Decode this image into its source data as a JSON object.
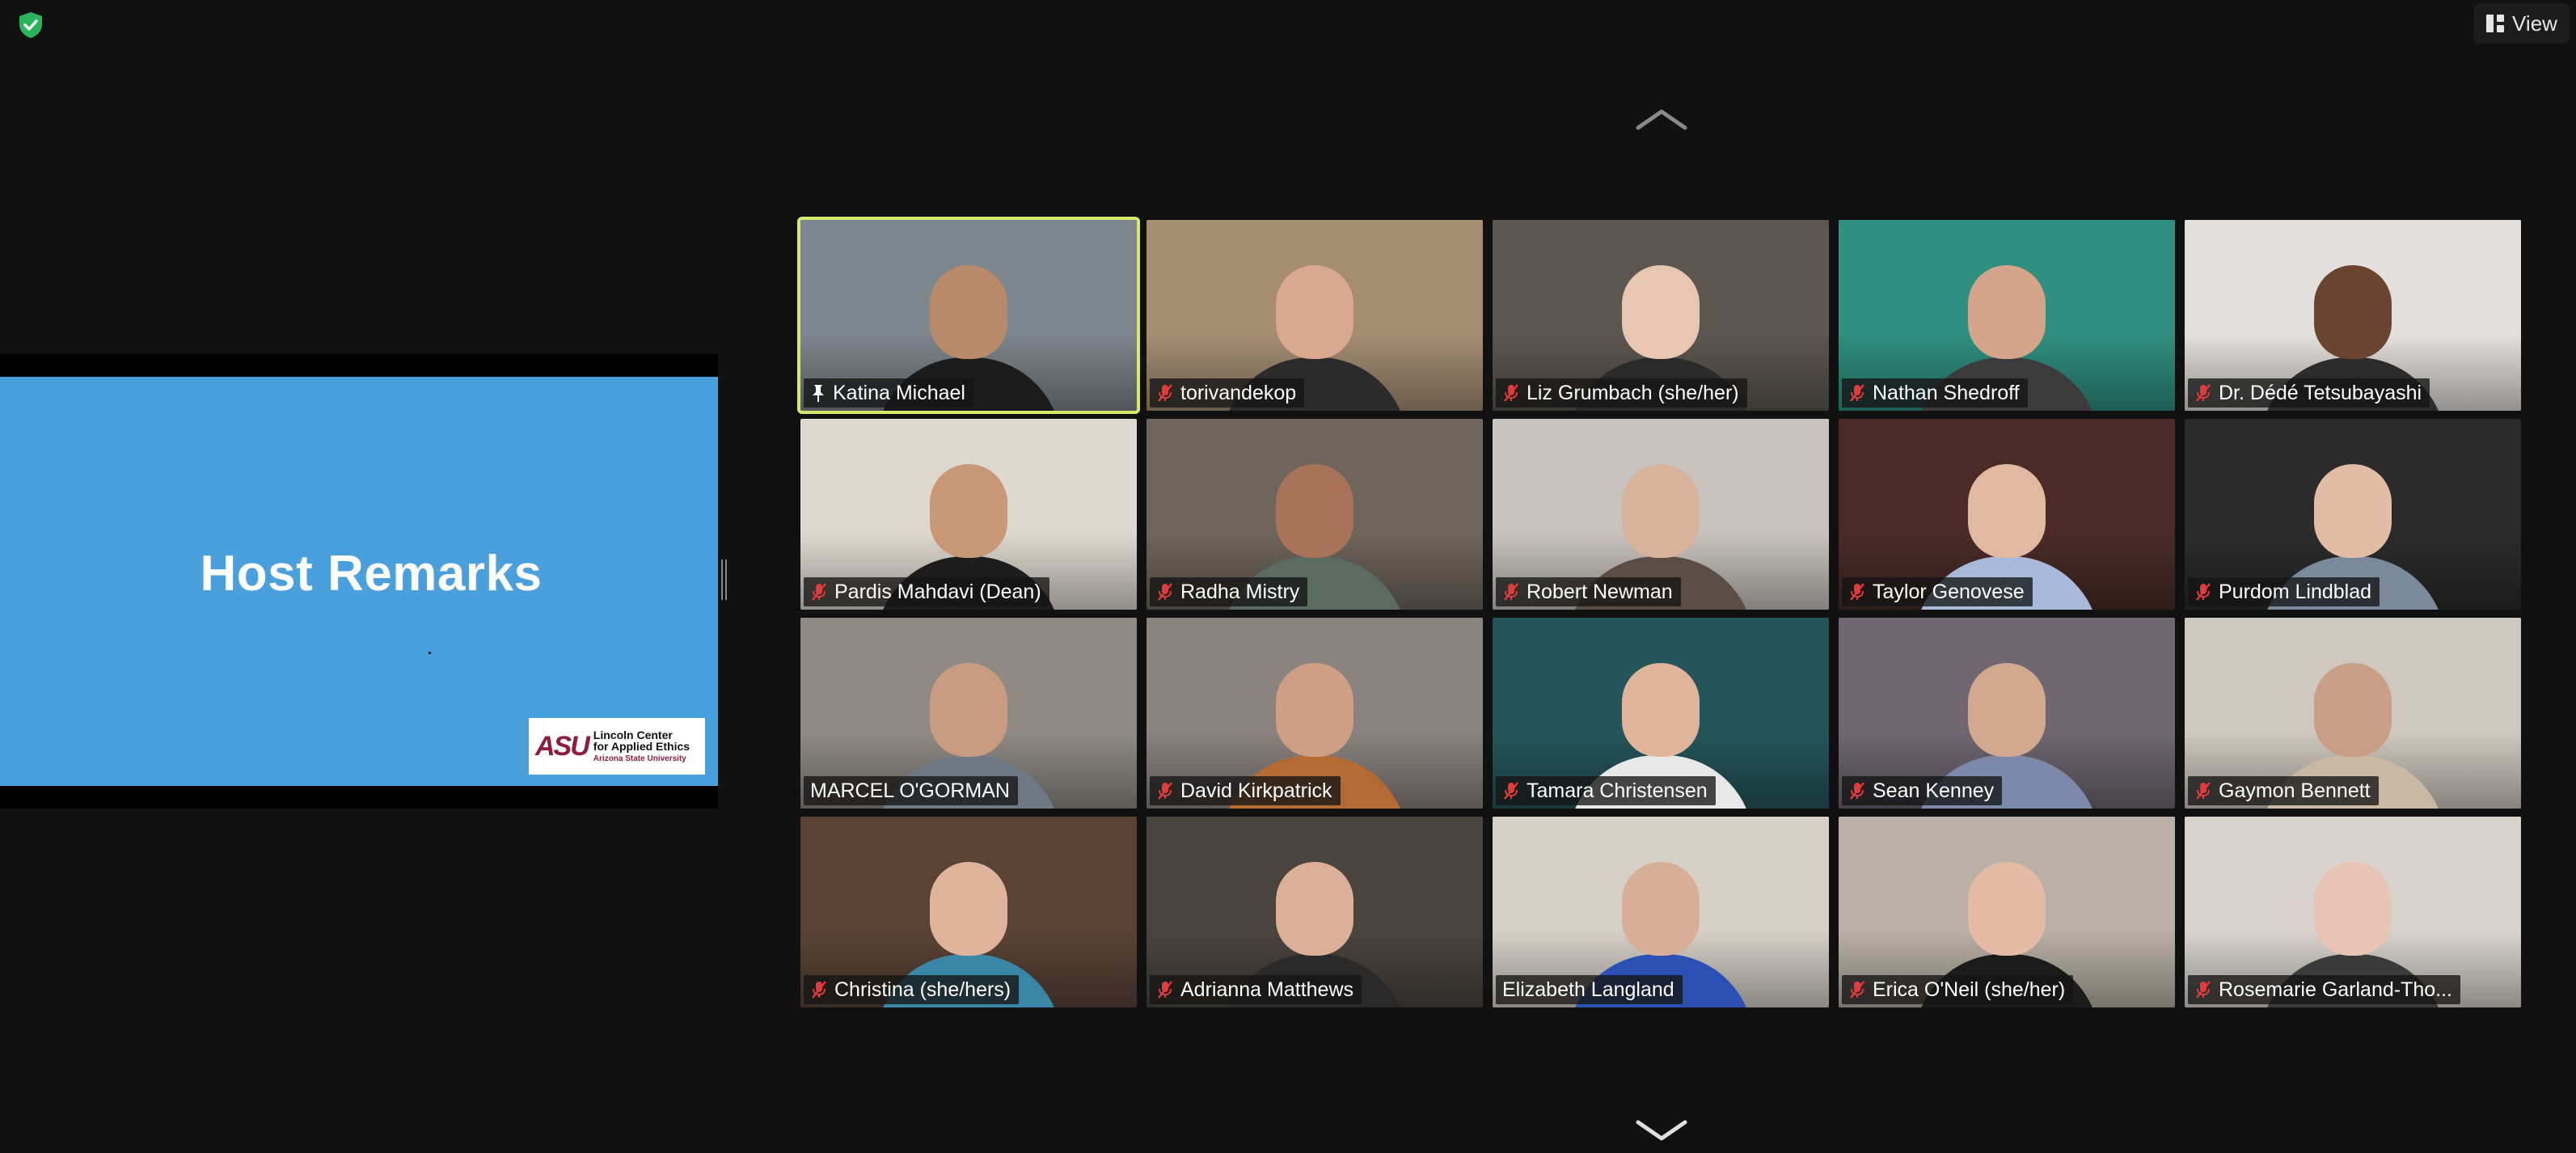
{
  "toolbar": {
    "view_label": "View"
  },
  "share": {
    "slide_title": "Host Remarks",
    "logo": {
      "mark": "ASU",
      "line1": "Lincoln Center",
      "line2": "for Applied Ethics",
      "line3": "Arizona State University"
    }
  },
  "participants": [
    {
      "name": "Katina Michael",
      "muted": false,
      "pinned": true,
      "active": true,
      "bg": "#7d868c",
      "skin": "#b98a6a",
      "shirt": "#1c1c1c"
    },
    {
      "name": "torivandekop",
      "muted": true,
      "bg": "#a58d72",
      "skin": "#d9a890",
      "shirt": "#2b2b2b"
    },
    {
      "name": "Liz Grumbach (she/her)",
      "muted": true,
      "bg": "#5c5650",
      "skin": "#e8c7b0",
      "shirt": "#2a2a2a"
    },
    {
      "name": "Nathan Shedroff",
      "muted": true,
      "bg": "#2f8f80",
      "skin": "#d4a58a",
      "shirt": "#3b3b3b"
    },
    {
      "name": "Dr. Dédé Tetsubayashi",
      "muted": true,
      "bg": "#e2dfdc",
      "skin": "#6b4331",
      "shirt": "#2c2c2c"
    },
    {
      "name": "Pardis Mahdavi (Dean)",
      "muted": true,
      "bg": "#ded9d0",
      "skin": "#c99877",
      "shirt": "#1d1d1d"
    },
    {
      "name": "Radha Mistry",
      "muted": true,
      "bg": "#6e655c",
      "skin": "#a9735a",
      "shirt": "#5a6b60"
    },
    {
      "name": "Robert Newman",
      "muted": true,
      "bg": "#c8c3be",
      "skin": "#d8b39c",
      "shirt": "#5b4d43"
    },
    {
      "name": "Taylor Genovese",
      "muted": true,
      "bg": "#4a2b26",
      "skin": "#e1b8a0",
      "shirt": "#a8b9d9"
    },
    {
      "name": "Purdom Lindblad",
      "muted": true,
      "bg": "#2b2b2b",
      "skin": "#e3bca6",
      "shirt": "#7a8a9a"
    },
    {
      "name": "MARCEL O'GORMAN",
      "muted": false,
      "bg": "#8f8a84",
      "skin": "#c99c82",
      "shirt": "#6d7a86"
    },
    {
      "name": "David Kirkpatrick",
      "muted": true,
      "bg": "#8a8380",
      "skin": "#cf9f85",
      "shirt": "#b36a33"
    },
    {
      "name": "Tamara Christensen",
      "muted": true,
      "bg": "#24555a",
      "skin": "#e0b59c",
      "shirt": "#e8e8e8"
    },
    {
      "name": "Sean Kenney",
      "muted": true,
      "bg": "#6e6670",
      "skin": "#d2a98e",
      "shirt": "#7c89a8"
    },
    {
      "name": "Gaymon Bennett",
      "muted": true,
      "bg": "#cfc8c0",
      "skin": "#c89f86",
      "shirt": "#c9b9a4"
    },
    {
      "name": "Christina (she/hers)",
      "muted": true,
      "bg": "#5a4335",
      "skin": "#e0b49a",
      "shirt": "#3a86a6"
    },
    {
      "name": "Adrianna Matthews",
      "muted": true,
      "bg": "#4a443f",
      "skin": "#dcb098",
      "shirt": "#2a2a2a"
    },
    {
      "name": "Elizabeth Langland",
      "muted": false,
      "bg": "#d6d0c8",
      "skin": "#d8ae96",
      "shirt": "#2c4fb3"
    },
    {
      "name": "Erica O'Neil (she/her)",
      "muted": true,
      "bg": "#b9b1a6",
      "skin": "#e6bba6",
      "shirt": "#1b1b1b"
    },
    {
      "name": "Rosemarie Garland-Tho...",
      "muted": true,
      "bg": "#d8d3cd",
      "skin": "#e7c4b4",
      "shirt": "#3a3a3a"
    }
  ]
}
